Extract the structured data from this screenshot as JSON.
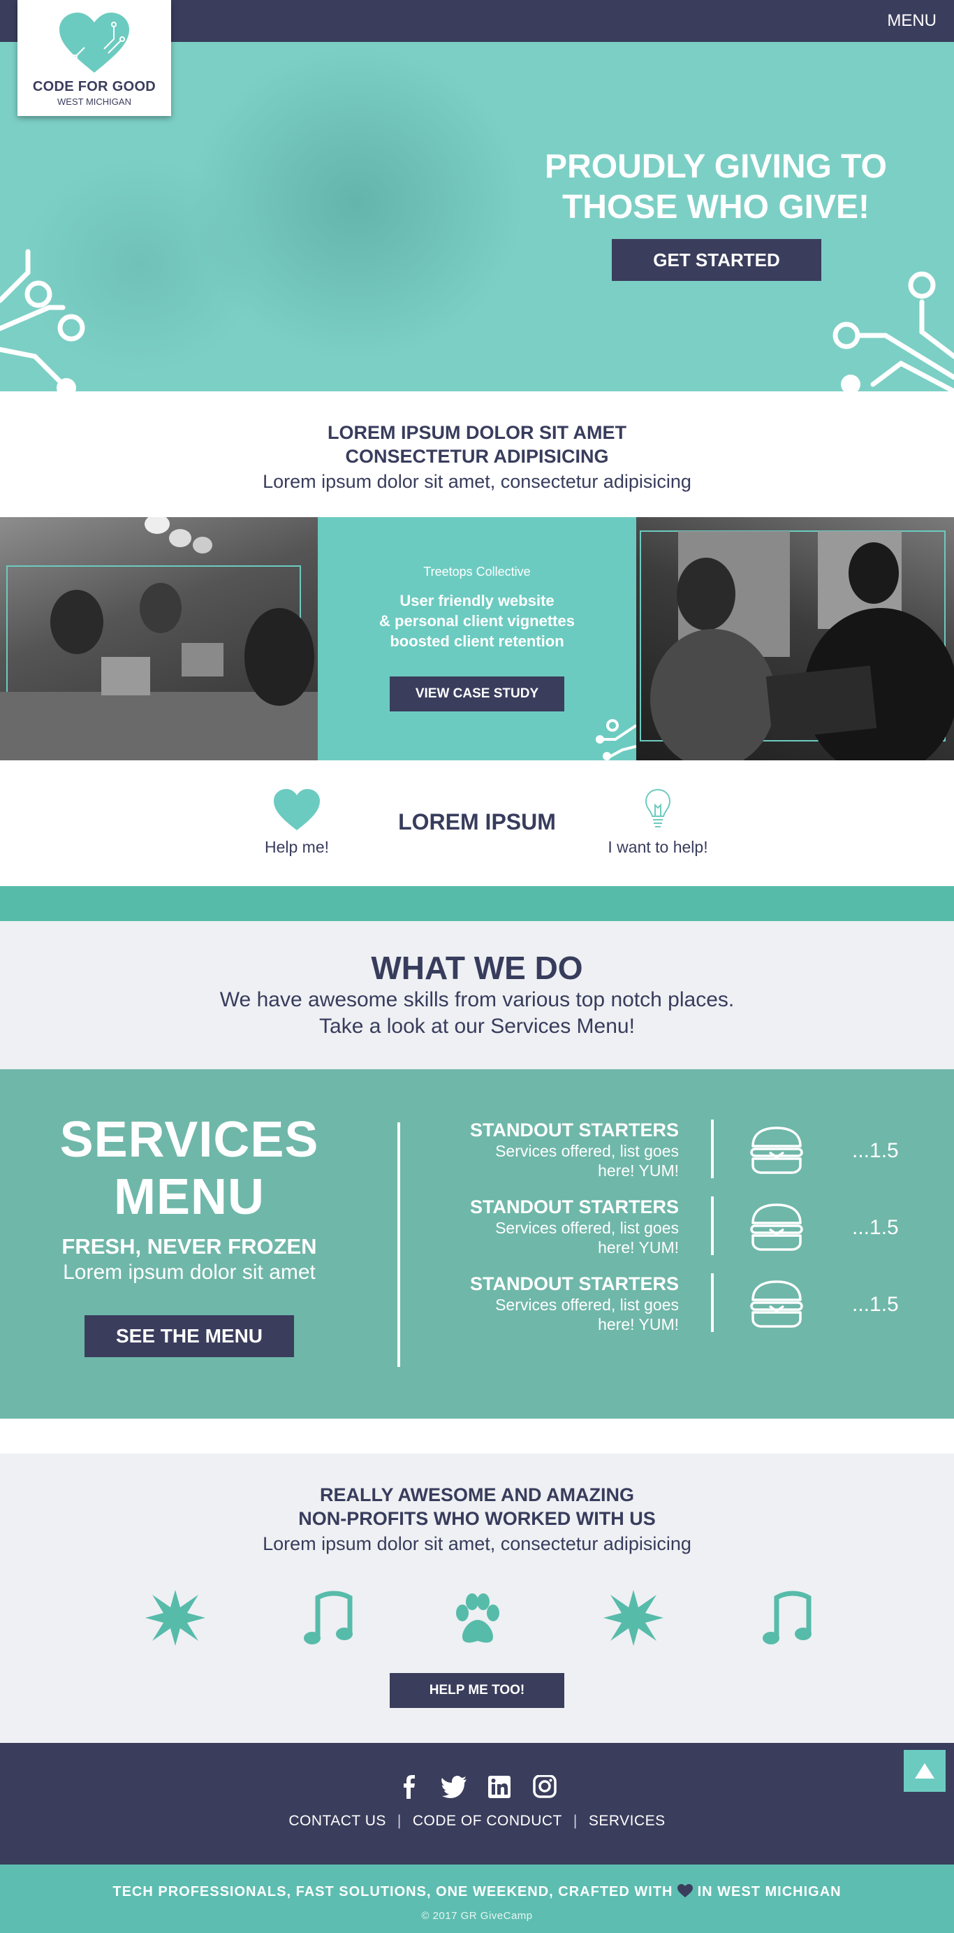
{
  "header": {
    "menu_label": "MENU",
    "logo_line1": "CODE FOR GOOD",
    "logo_line2": "WEST MICHIGAN"
  },
  "hero": {
    "title": "PROUDLY GIVING TO THOSE WHO GIVE!",
    "cta_label": "GET STARTED"
  },
  "intro": {
    "heading_line1": "LOREM IPSUM DOLOR SIT AMET",
    "heading_line2": "CONSECTETUR ADIPISICING",
    "subtitle": "Lorem ipsum dolor sit amet, consectetur adipisicing"
  },
  "case_study": {
    "org": "Treetops Collective",
    "desc_line1": "User friendly website",
    "desc_line2": "& personal client vignettes",
    "desc_line3": "boosted client retention",
    "button_label": "VIEW CASE STUDY"
  },
  "help": {
    "left_label": "Help me!",
    "title": "LOREM IPSUM",
    "right_label": "I want to help!"
  },
  "what_we_do": {
    "title": "WHAT WE DO",
    "line1": "We have awesome skills from various top notch places.",
    "line2": "Take a look at our Services Menu!"
  },
  "services": {
    "title_line1": "SERVICES",
    "title_line2": "MENU",
    "tagline": "FRESH, NEVER FROZEN",
    "subtitle": "Lorem ipsum dolor sit amet",
    "button_label": "SEE THE MENU",
    "items": [
      {
        "title": "STANDOUT STARTERS",
        "line1": "Services offered, list goes",
        "line2": "here! YUM!",
        "price": "...1.5"
      },
      {
        "title": "STANDOUT STARTERS",
        "line1": "Services offered, list goes",
        "line2": "here! YUM!",
        "price": "...1.5"
      },
      {
        "title": "STANDOUT STARTERS",
        "line1": "Services offered, list goes",
        "line2": "here! YUM!",
        "price": "...1.5"
      }
    ]
  },
  "nonprofits": {
    "heading_line1": "REALLY AWESOME AND AMAZING",
    "heading_line2": "NON-PROFITS WHO WORKED WITH US",
    "subtitle": "Lorem ipsum dolor sit amet, consectetur adipisicing",
    "icons": [
      "starburst-icon",
      "music-note-icon",
      "paw-icon",
      "starburst-icon",
      "music-note-icon"
    ],
    "button_label": "HELP ME TOO!"
  },
  "footer": {
    "social": [
      "facebook-icon",
      "twitter-icon",
      "linkedin-icon",
      "instagram-icon"
    ],
    "links": [
      "CONTACT US",
      "CODE OF CONDUCT",
      "SERVICES"
    ],
    "separator": "|",
    "tagline_before": "TECH PROFESSIONALS, FAST SOLUTIONS, ONE WEEKEND, CRAFTED WITH",
    "tagline_after": "IN WEST MICHIGAN",
    "copyright": "© 2017 GR GiveCamp"
  },
  "colors": {
    "navy": "#3a3d5c",
    "teal": "#6ccbc0",
    "services_teal": "#6fb7a9",
    "light_gray": "#eef0f3"
  }
}
